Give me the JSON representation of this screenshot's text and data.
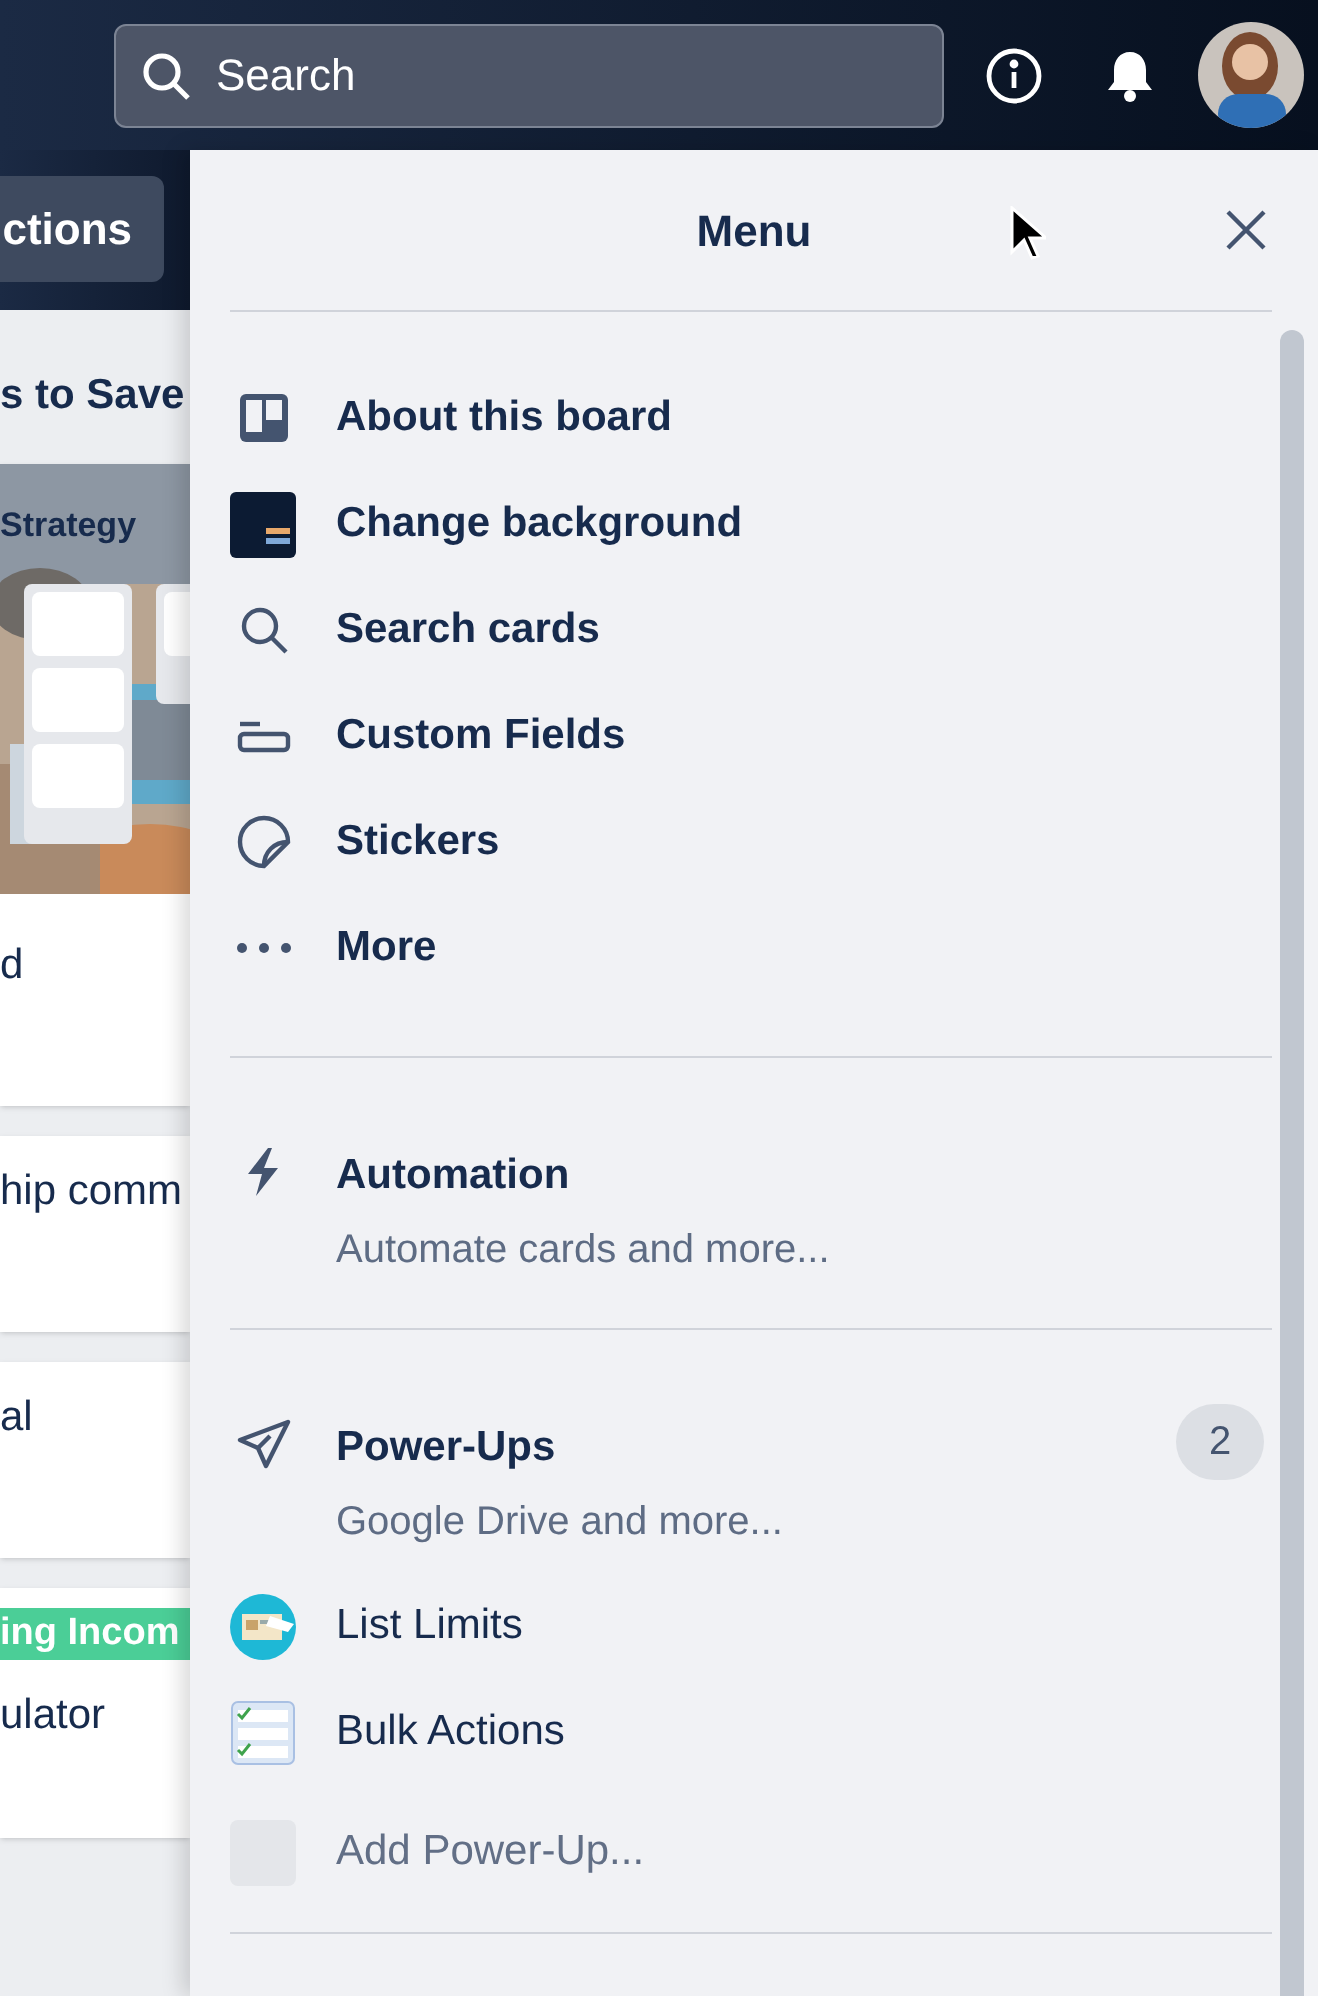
{
  "topbar": {
    "search": {
      "placeholder": "Search"
    }
  },
  "board": {
    "button": "ctions",
    "list_title": "s to Save",
    "cards": [
      {
        "kind": "picture",
        "title": "Strategy",
        "text": "d"
      },
      {
        "kind": "text",
        "text": "hip comm"
      },
      {
        "kind": "text",
        "text": "al"
      },
      {
        "kind": "label",
        "label": "ing Incom",
        "color": "#4bce97",
        "text": "ulator"
      }
    ]
  },
  "menu": {
    "title": "Menu",
    "sections": [
      {
        "items": [
          {
            "label": "About this board"
          },
          {
            "label": "Change background"
          },
          {
            "label": "Search cards"
          },
          {
            "label": "Custom Fields"
          },
          {
            "label": "Stickers"
          },
          {
            "label": "More"
          }
        ]
      },
      {
        "items": [
          {
            "label": "Automation",
            "subtitle": "Automate cards and more..."
          }
        ]
      },
      {
        "items": [
          {
            "label": "Power-Ups",
            "subtitle": "Google Drive and more...",
            "badge": "2"
          },
          {
            "label": "List Limits"
          },
          {
            "label": "Bulk Actions"
          },
          {
            "label": "Add Power-Up...",
            "disabled": true
          }
        ]
      }
    ]
  }
}
